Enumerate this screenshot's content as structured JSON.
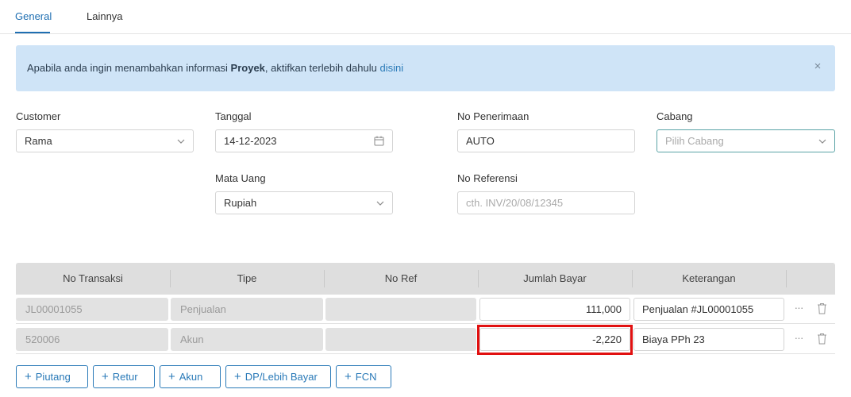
{
  "tabs": [
    {
      "label": "General",
      "active": true
    },
    {
      "label": "Lainnya",
      "active": false
    }
  ],
  "alert": {
    "text_before": "Apabila anda ingin menambahkan informasi ",
    "bold": "Proyek",
    "text_after": ", aktifkan terlebih dahulu ",
    "link": "disini",
    "close": "×"
  },
  "form": {
    "customer": {
      "label": "Customer",
      "value": "Rama"
    },
    "tanggal": {
      "label": "Tanggal",
      "value": "14-12-2023"
    },
    "no_penerimaan": {
      "label": "No Penerimaan",
      "value": "AUTO"
    },
    "cabang": {
      "label": "Cabang",
      "placeholder": "Pilih Cabang"
    },
    "mata_uang": {
      "label": "Mata Uang",
      "value": "Rupiah"
    },
    "no_referensi": {
      "label": "No Referensi",
      "placeholder": "cth. INV/20/08/12345"
    }
  },
  "table": {
    "columns": [
      "No Transaksi",
      "Tipe",
      "No Ref",
      "Jumlah Bayar",
      "Keterangan"
    ],
    "rows": [
      {
        "no_transaksi": "JL00001055",
        "tipe": "Penjualan",
        "no_ref": "",
        "jumlah_bayar": "111,000",
        "keterangan": "Penjualan #JL00001055"
      },
      {
        "no_transaksi": "520006",
        "tipe": "Akun",
        "no_ref": "",
        "jumlah_bayar": "-2,220",
        "keterangan": "Biaya PPh 23"
      }
    ],
    "more_glyph": "···"
  },
  "buttons": [
    {
      "label": "Piutang"
    },
    {
      "label": "Retur"
    },
    {
      "label": "Akun"
    },
    {
      "label": "DP/Lebih Bayar"
    },
    {
      "label": "FCN"
    }
  ],
  "colors": {
    "accent": "#1f6fb2",
    "alert_bg": "#cfe4f7",
    "highlight": "#e11010"
  }
}
